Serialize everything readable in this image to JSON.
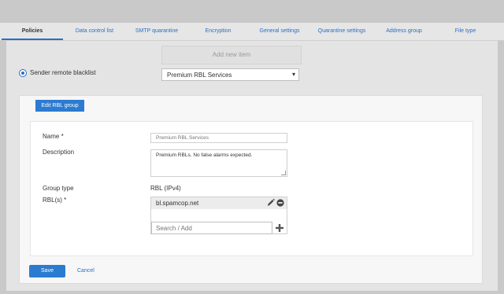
{
  "tabs": [
    {
      "label": "Policies",
      "active": true
    },
    {
      "label": "Data control list"
    },
    {
      "label": "SMTP quarantine"
    },
    {
      "label": "Encryption"
    },
    {
      "label": "General settings"
    },
    {
      "label": "Quarantine settings"
    },
    {
      "label": "Address group"
    },
    {
      "label": "File type"
    }
  ],
  "top": {
    "add_new_label": "Add new item",
    "radio_label": "Sender remote blacklist",
    "radio_selected": true,
    "select_value": "Premium RBL Services"
  },
  "panel": {
    "edit_button_label": "Edit RBL group",
    "form": {
      "name_label": "Name",
      "required_mark": "*",
      "name_placeholder": "Premium RBL Services",
      "description_label": "Description",
      "description_value": "Premium RBLs. No false alarms expected.",
      "group_type_label": "Group type",
      "group_type_value": "RBL (IPv4)",
      "rbls_label": "RBL(s)",
      "rbl_items": [
        "bl.spamcop.net"
      ],
      "search_placeholder": "Search / Add"
    }
  },
  "footer": {
    "save_label": "Save",
    "cancel_label": "Cancel"
  },
  "icons": {
    "edit": "pencil-icon",
    "remove": "minus-circle-icon",
    "add": "plus-icon",
    "dropdown": "chevron-down-icon"
  },
  "colors": {
    "accent": "#2b7bd1",
    "link": "#2a6fc4"
  }
}
